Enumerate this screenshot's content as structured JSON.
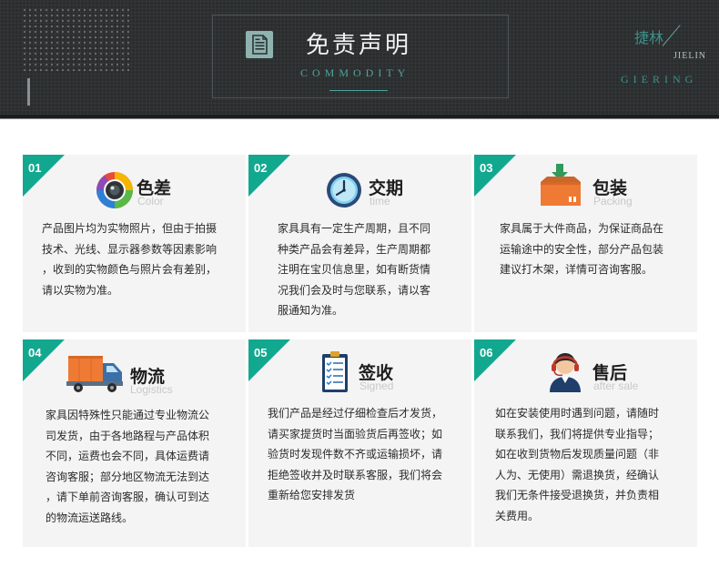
{
  "header": {
    "title": "免责声明",
    "subtitle": "COMMODITY",
    "brand_cn": "捷林",
    "brand_en_small": "JIELIN",
    "brand_en_wide": "GIERING"
  },
  "colors": {
    "accent": "#12a890",
    "banner": "#2a2d2e",
    "card_bg": "#f4f4f4"
  },
  "cards": [
    {
      "num": "01",
      "title": "色差",
      "en": "Color",
      "icon": "camera-lens-icon",
      "lines": [
        "产品图片均为实物照片，但由于拍摄",
        "技术、光线、显示器参数等因素影响",
        "，收到的实物颜色与照片会有差别，",
        "请以实物为准。"
      ]
    },
    {
      "num": "02",
      "title": "交期",
      "en": "time",
      "icon": "clock-icon",
      "lines": [
        "家具具有一定生产周期，且不同",
        "种类产品会有差异，生产周期都",
        "注明在宝贝信息里，如有断货情",
        "况我们会及时与您联系，请以客",
        "服通知为准。"
      ]
    },
    {
      "num": "03",
      "title": "包装",
      "en": "Packing",
      "icon": "package-box-icon",
      "lines": [
        "家具属于大件商品，为保证商品在",
        "运输途中的安全性，部分产品包装",
        "建议打木架，详情可咨询客服。"
      ]
    },
    {
      "num": "04",
      "title": "物流",
      "en": "Logistics",
      "icon": "delivery-truck-icon",
      "lines": [
        "家具因特殊性只能通过专业物流公",
        "司发货，由于各地路程与产品体积",
        "不同，运费也会不同，具体运费请",
        "咨询客服；部分地区物流无法到达",
        "，请下单前咨询客服，确认可到达",
        "的物流运送路线。"
      ]
    },
    {
      "num": "05",
      "title": "签收",
      "en": "Signed",
      "icon": "checklist-icon",
      "lines": [
        "我们产品是经过仔细检查后才发货，",
        "请买家提货时当面验货后再签收；如",
        "验货时发现件数不齐或运输损坏，请",
        "拒绝签收并及时联系客服，我们将会",
        "重新给您安排发货"
      ]
    },
    {
      "num": "06",
      "title": "售后",
      "en": "after sale",
      "icon": "customer-service-icon",
      "lines": [
        "如在安装使用时遇到问题，请随时",
        "联系我们，我们将提供专业指导；",
        "如在收到货物后发现质量问题（非",
        "人为、无使用）需退换货，经确认",
        "我们无条件接受退换货，并负责相",
        "关费用。"
      ]
    }
  ]
}
